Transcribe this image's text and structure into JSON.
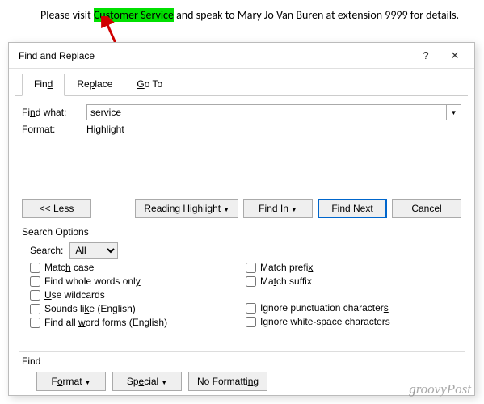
{
  "document": {
    "prefix": "Please visit ",
    "highlighted": "Customer Service",
    "suffix": " and speak to Mary Jo Van Buren at extension 9999 for details."
  },
  "dialog": {
    "title": "Find and Replace",
    "help": "?",
    "close": "✕",
    "tabs": {
      "find": "Find",
      "replace": "Replace",
      "goto": "Go To"
    },
    "findwhat_label": "Find what:",
    "findwhat_value": "service",
    "format_label": "Format:",
    "format_value": "Highlight",
    "buttons": {
      "less": "<< Less",
      "reading_highlight": "Reading Highlight",
      "find_in": "Find In",
      "find_next": "Find Next",
      "cancel": "Cancel"
    },
    "search_options_label": "Search Options",
    "search_label": "Search:",
    "search_value": "All",
    "checks": {
      "match_case": "Match case",
      "whole_words": "Find whole words only",
      "wildcards": "Use wildcards",
      "sounds_like": "Sounds like (English)",
      "word_forms": "Find all word forms (English)",
      "match_prefix": "Match prefix",
      "match_suffix": "Match suffix",
      "ignore_punct": "Ignore punctuation characters",
      "ignore_ws": "Ignore white-space characters"
    },
    "find_section_label": "Find",
    "bottom_buttons": {
      "format": "Format",
      "special": "Special",
      "no_formatting": "No Formatting"
    }
  },
  "watermark": "groovyPost"
}
